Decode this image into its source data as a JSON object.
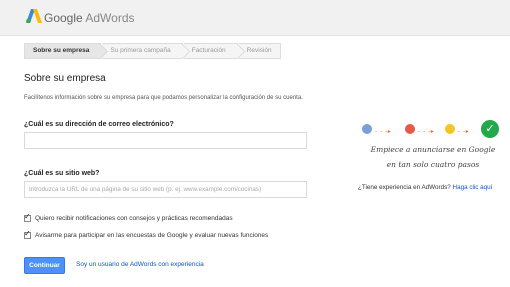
{
  "header": {
    "logo_google": "Google",
    "logo_adwords": "AdWords"
  },
  "steps": [
    {
      "label": "Sobre su empresa",
      "active": true
    },
    {
      "label": "Su primera campaña",
      "active": false
    },
    {
      "label": "Facturación",
      "active": false
    },
    {
      "label": "Revisión",
      "active": false
    }
  ],
  "main": {
    "title": "Sobre su empresa",
    "subtitle": "Facilítenos información sobre su empresa para que podamos personalizar la configuración de su cuenta.",
    "email_label": "¿Cuál es su dirección de correo electrónico?",
    "email_value": "",
    "website_label": "¿Cuál es su sitio web?",
    "website_placeholder": "Introduzca la URL de una página de su sitio web (p. ej.  www.example.com/cocinas)",
    "check1": "Quiero recibir notificaciones con consejos y prácticas recomendadas",
    "check2": "Avisarme para participar en las encuestas de Google y evaluar nuevas funciones",
    "continue_label": "Continuar",
    "existing_link": "Soy un usuario de AdWords con experiencia"
  },
  "side": {
    "tagline_1": "Empiece a anunciarse en Google",
    "tagline_2": "en tan solo cuatro pasos",
    "experience_text": "¿Tiene experiencia en AdWords?",
    "experience_link": "Haga clic aquí",
    "colors": {
      "blue": "#7aa0d9",
      "red": "#e8594a",
      "yellow": "#f3c623",
      "green": "#23a94a",
      "arrow": "#f06a21"
    }
  },
  "colors": {
    "primary_button": "#4d90fe",
    "link": "#1155cc"
  }
}
